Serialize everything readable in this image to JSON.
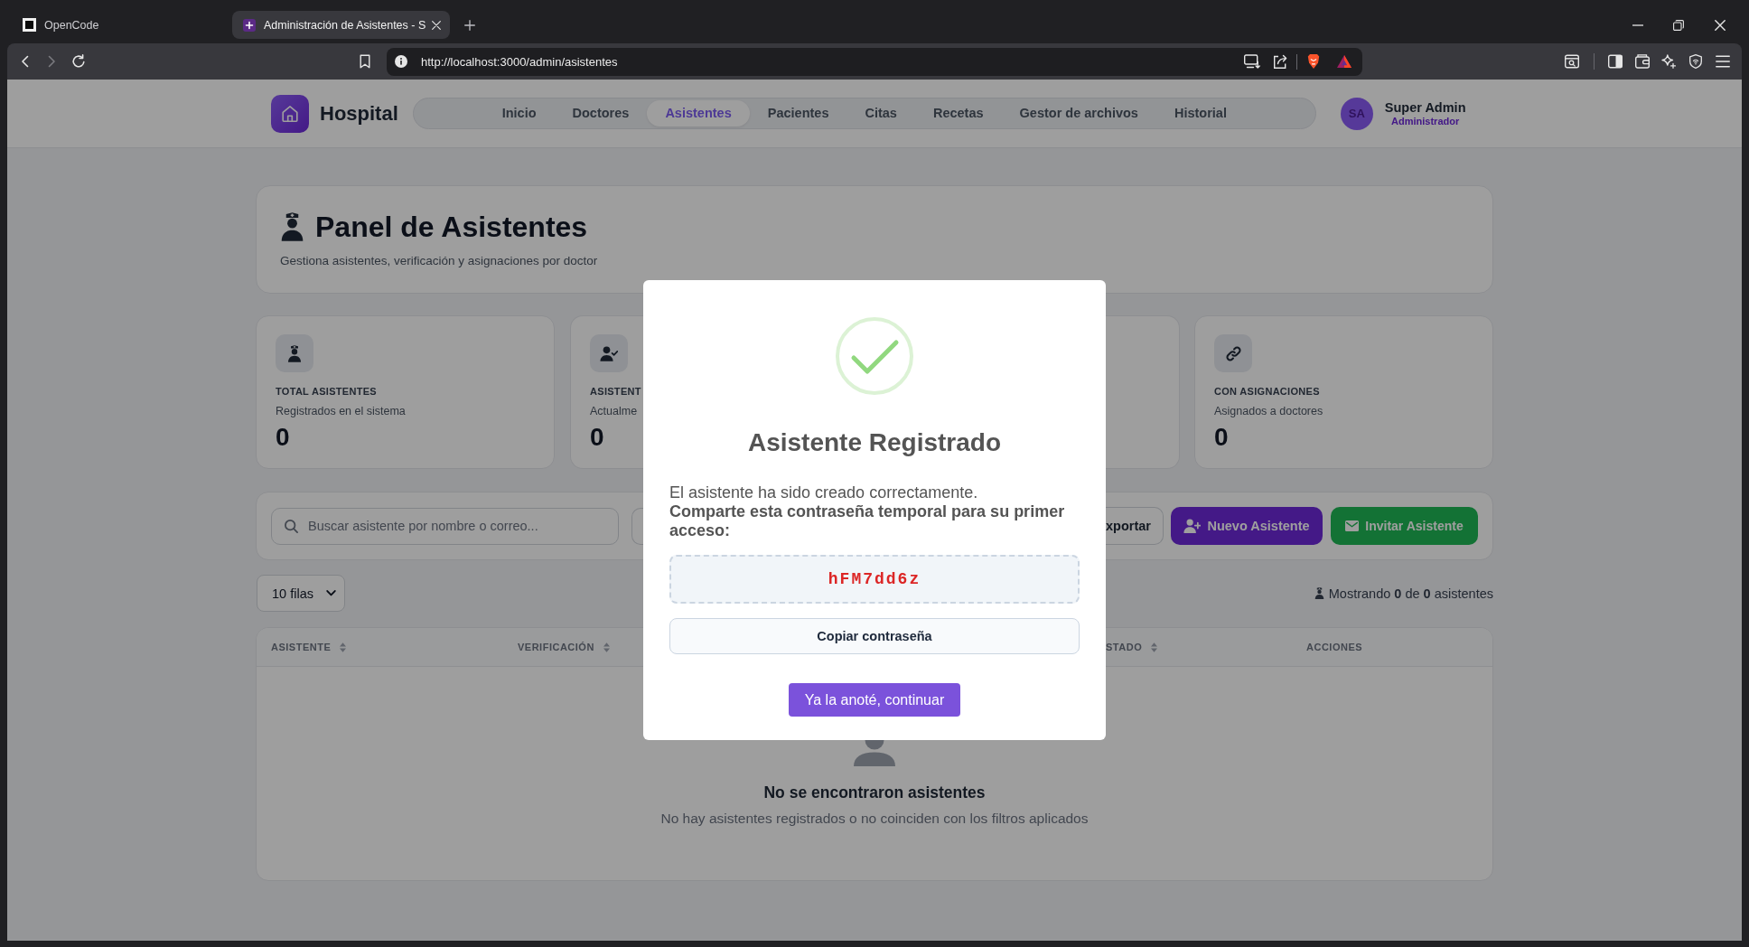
{
  "browser": {
    "tabs": [
      {
        "title": "OpenCode",
        "selected": false
      },
      {
        "title": "Administración de Asistentes - S",
        "selected": true
      }
    ],
    "address": "http://localhost:3000/admin/asistentes"
  },
  "header": {
    "brand": "Hospital",
    "nav": [
      {
        "label": "Inicio",
        "selected": false
      },
      {
        "label": "Doctores",
        "selected": false
      },
      {
        "label": "Asistentes",
        "selected": true
      },
      {
        "label": "Pacientes",
        "selected": false
      },
      {
        "label": "Citas",
        "selected": false
      },
      {
        "label": "Recetas",
        "selected": false
      },
      {
        "label": "Gestor de archivos",
        "selected": false
      },
      {
        "label": "Historial",
        "selected": false
      }
    ],
    "user": {
      "initials": "SA",
      "name": "Super Admin",
      "role": "Administrador"
    }
  },
  "page": {
    "title": "Panel de Asistentes",
    "subtitle": "Gestiona asistentes, verificación y asignaciones por doctor"
  },
  "stats": [
    {
      "kind": "total",
      "label": "TOTAL ASISTENTES",
      "caption": "Registrados en el sistema",
      "value": "0"
    },
    {
      "kind": "active",
      "label": "ASISTENT",
      "caption": "Actualme",
      "value": "0"
    },
    {
      "kind": "assigned",
      "label": "CON ASIGNACIONES",
      "caption": "Asignados a doctores",
      "value": "0"
    }
  ],
  "toolbar": {
    "search": {
      "placeholder": "Buscar asistente por nombre o correo..."
    },
    "buttons": [
      {
        "kind": "outline",
        "label": "xportar"
      },
      {
        "kind": "primary",
        "label": "Nuevo Asistente"
      },
      {
        "kind": "success",
        "label": "Invitar Asistente"
      }
    ]
  },
  "table": {
    "page_size": "10 filas",
    "summary": "Mostrando **0** de **0** asistentes",
    "columns": [
      {
        "label": "ASISTENTE",
        "sortable": true
      },
      {
        "label": "VERIFICACIÓN",
        "sortable": true
      },
      {
        "label": "STADO",
        "sortable": true
      },
      {
        "label": "ACCIONES",
        "sortable": false
      }
    ],
    "empty": {
      "title": "No se encontraron asistentes",
      "message": "No hay asistentes registrados o no coinciden con los filtros aplicados"
    }
  },
  "dialog": {
    "title": "Asistente Registrado",
    "message": "El asistente ha sido creado correctamente.",
    "instruction": "Comparte esta contraseña temporal para su primer acceso:",
    "password": "hFM7dd6z",
    "buttons": [
      {
        "kind": "secondary",
        "label": "Copiar contraseña"
      },
      {
        "kind": "primary",
        "label": "Ya la anoté, continuar"
      }
    ]
  }
}
